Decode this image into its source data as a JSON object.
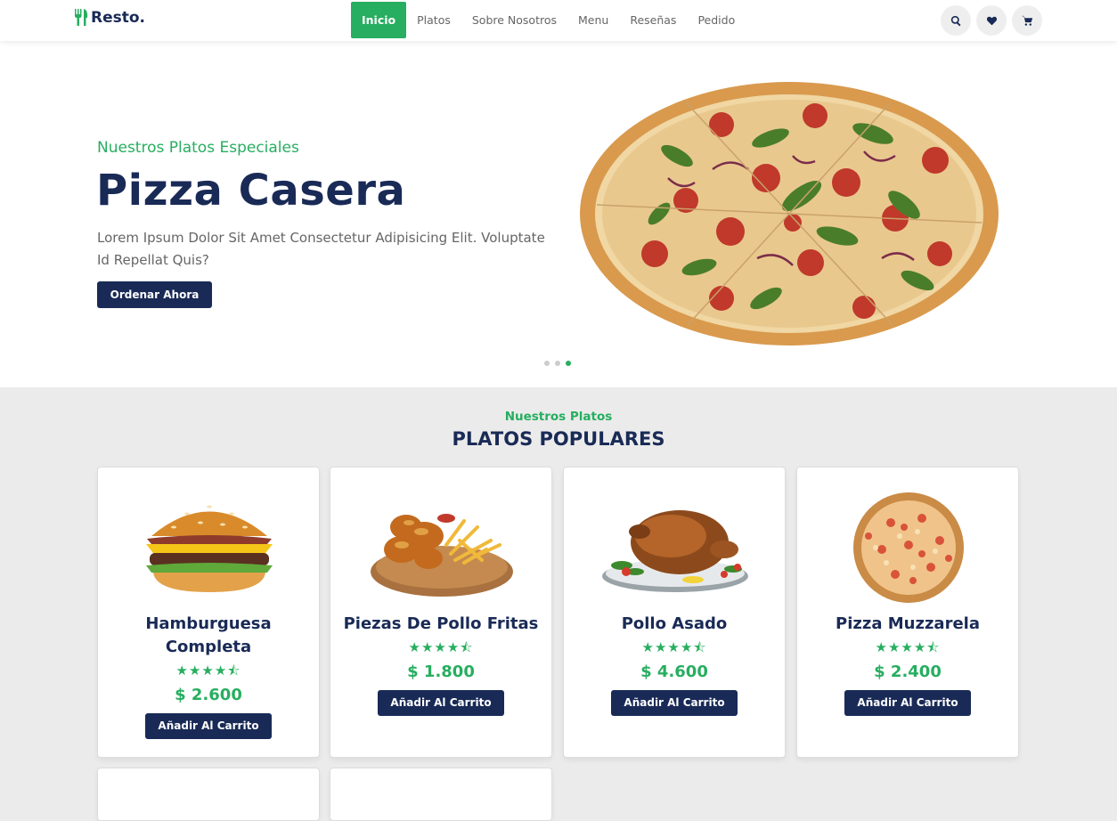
{
  "header": {
    "logo": "Resto.",
    "nav": [
      "Inicio",
      "Platos",
      "Sobre Nosotros",
      "Menu",
      "Reseñas",
      "Pedido"
    ],
    "active_nav": "Inicio",
    "icons": [
      "search-icon",
      "heart-icon",
      "cart-icon"
    ]
  },
  "hero": {
    "subtitle": "Nuestros Platos Especiales",
    "title": "Pizza Casera",
    "text": "Lorem Ipsum Dolor Sit Amet Consectetur Adipisicing Elit. Voluptate Id Repellat Quis?",
    "button": "Ordenar Ahora",
    "slides_total": 3,
    "active_slide": 3
  },
  "section": {
    "subtitle": "Nuestros Platos",
    "title": "PLATOS POPULARES"
  },
  "dishes": [
    {
      "name": "Hamburguesa Completa",
      "price": "$ 2.600",
      "rating": 4.5,
      "button": "Añadir Al Carrito",
      "image": "burger-image"
    },
    {
      "name": "Piezas De Pollo Fritas",
      "price": "$ 1.800",
      "rating": 4.5,
      "button": "Añadir Al Carrito",
      "image": "fried-chicken-image"
    },
    {
      "name": "Pollo Asado",
      "price": "$ 4.600",
      "rating": 4.5,
      "button": "Añadir Al Carrito",
      "image": "roast-chicken-image"
    },
    {
      "name": "Pizza Muzzarela",
      "price": "$ 2.400",
      "rating": 4.5,
      "button": "Añadir Al Carrito",
      "image": "pizza-image"
    }
  ],
  "colors": {
    "primary": "#192a56",
    "accent": "#27ae60",
    "background": "#ebebeb"
  }
}
